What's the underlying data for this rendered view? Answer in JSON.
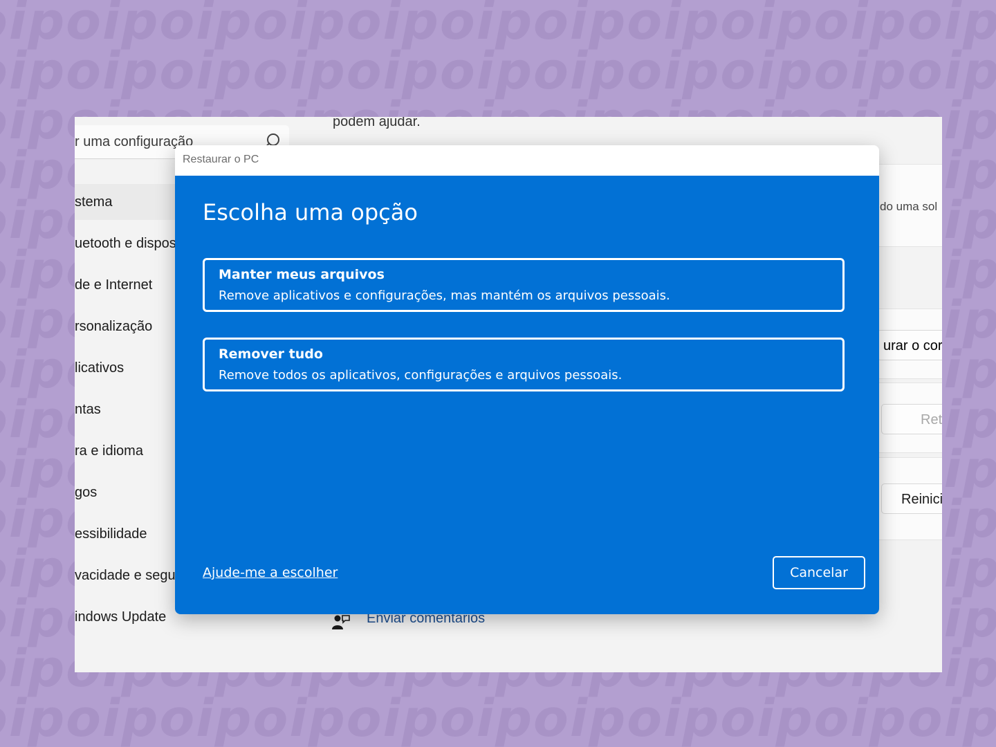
{
  "watermark": {
    "text": "oipoipoipoipoipoipoipoipoipoipoip"
  },
  "settings": {
    "search": {
      "placeholder": "r uma configuração"
    },
    "nav_items": [
      "stema",
      "uetooth e dispos",
      "de e Internet",
      "rsonalização",
      "licativos",
      "ntas",
      "ra e idioma",
      "gos",
      "essibilidade",
      "vacidade e segu",
      "indows Update"
    ],
    "top_text": "podem ajudar.",
    "right_texts": {
      "card1": "do uma sol",
      "card2": "urar o cor",
      "button1": "Ret",
      "button2": "Reinici"
    },
    "feedback": "Enviar comentários"
  },
  "dialog": {
    "title": "Restaurar o PC",
    "heading": "Escolha uma opção",
    "options": [
      {
        "title": "Manter meus arquivos",
        "description": "Remove aplicativos e configurações, mas mantém os arquivos pessoais."
      },
      {
        "title": "Remover tudo",
        "description": "Remove todos os aplicativos, configurações e arquivos pessoais."
      }
    ],
    "help_link": "Ajude-me a escolher",
    "cancel": "Cancelar"
  },
  "colors": {
    "background": "#b39fd0",
    "dialog_blue": "#0271d5",
    "link_blue": "#1d4f91"
  }
}
